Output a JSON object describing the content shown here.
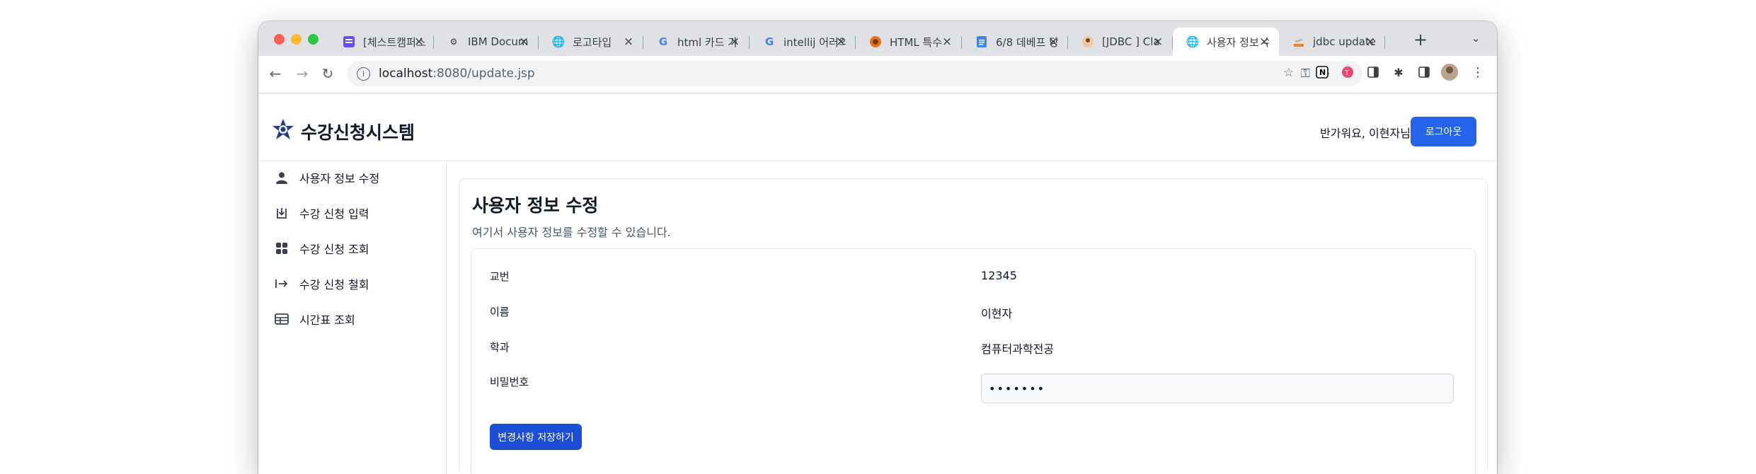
{
  "browser": {
    "tabs": [
      {
        "title": "[체스트캠퍼스",
        "favicon": "notion-purple-icon",
        "active": false
      },
      {
        "title": "IBM Docum",
        "favicon": "ibm-icon",
        "active": false
      },
      {
        "title": "로고타입",
        "favicon": "globe-icon",
        "active": false
      },
      {
        "title": "html 카드 가",
        "favicon": "google-icon",
        "active": false
      },
      {
        "title": "intellij 어러의",
        "favicon": "google-icon",
        "active": false
      },
      {
        "title": "HTML 특수",
        "favicon": "html-icon",
        "active": false
      },
      {
        "title": "6/8 데베프 당",
        "favicon": "docs-icon",
        "active": false
      },
      {
        "title": "[JDBC ] Cla",
        "favicon": "avatar-icon",
        "active": false
      },
      {
        "title": "사용자 정보 수",
        "favicon": "globe-icon",
        "active": true
      },
      {
        "title": "jdbc update",
        "favicon": "stackoverflow-icon",
        "active": false
      }
    ],
    "url_host": "localhost",
    "url_path": ":8080/update.jsp"
  },
  "header": {
    "brand": "수강신청시스템",
    "welcome": "반가워요, 이현자님!",
    "logout_label": "로그아웃"
  },
  "sidebar": {
    "items": [
      {
        "label": "사용자 정보 수정",
        "icon": "user-icon"
      },
      {
        "label": "수강 신청 입력",
        "icon": "inbox-download-icon"
      },
      {
        "label": "수강 신청 조회",
        "icon": "grid-icon"
      },
      {
        "label": "수강 신청 철회",
        "icon": "arrow-right-bar-icon"
      },
      {
        "label": "시간표 조회",
        "icon": "table-icon"
      }
    ]
  },
  "main": {
    "title": "사용자 정보 수정",
    "description": "여기서 사용자 정보를 수정할 수 있습니다.",
    "fields": {
      "id_label": "교번",
      "id_value": "12345",
      "name_label": "이름",
      "name_value": "이현자",
      "dept_label": "학과",
      "dept_value": "컴퓨터과학전공",
      "password_label": "비밀번호",
      "password_value": "•••••••"
    },
    "save_label": "변경사항 저장하기"
  },
  "colors": {
    "primary": "#2563eb",
    "tabstrip": "#dfe1e5"
  }
}
